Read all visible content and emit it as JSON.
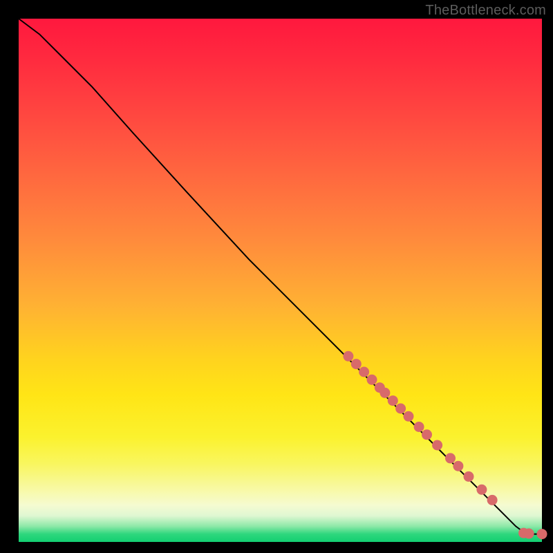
{
  "attribution": "TheBottleneck.com",
  "colors": {
    "dot": "#d86a6a",
    "curve": "#000000"
  },
  "chart_data": {
    "type": "line",
    "title": "",
    "xlabel": "",
    "ylabel": "",
    "xlim": [
      0,
      100
    ],
    "ylim": [
      0,
      100
    ],
    "grid": false,
    "series": [
      {
        "name": "curve",
        "x": [
          0,
          4,
          8,
          14,
          22,
          32,
          44,
          56,
          66,
          74,
          82,
          88,
          92,
          95,
          97,
          100
        ],
        "y": [
          100,
          97,
          93,
          87,
          78,
          67,
          54,
          42,
          32,
          24,
          16,
          10,
          6,
          3,
          1.5,
          1.5
        ]
      }
    ],
    "scatter_points": {
      "name": "dots-on-curve",
      "points": [
        {
          "x": 63.0,
          "y": 35.5
        },
        {
          "x": 64.5,
          "y": 34.0
        },
        {
          "x": 66.0,
          "y": 32.5
        },
        {
          "x": 67.5,
          "y": 31.0
        },
        {
          "x": 69.0,
          "y": 29.5
        },
        {
          "x": 70.0,
          "y": 28.5
        },
        {
          "x": 71.5,
          "y": 27.0
        },
        {
          "x": 73.0,
          "y": 25.5
        },
        {
          "x": 74.5,
          "y": 24.0
        },
        {
          "x": 76.5,
          "y": 22.0
        },
        {
          "x": 78.0,
          "y": 20.5
        },
        {
          "x": 80.0,
          "y": 18.5
        },
        {
          "x": 82.5,
          "y": 16.0
        },
        {
          "x": 84.0,
          "y": 14.5
        },
        {
          "x": 86.0,
          "y": 12.5
        },
        {
          "x": 88.5,
          "y": 10.0
        },
        {
          "x": 90.5,
          "y": 8.0
        },
        {
          "x": 96.5,
          "y": 1.7
        },
        {
          "x": 97.5,
          "y": 1.6
        },
        {
          "x": 100.0,
          "y": 1.5
        }
      ]
    }
  }
}
